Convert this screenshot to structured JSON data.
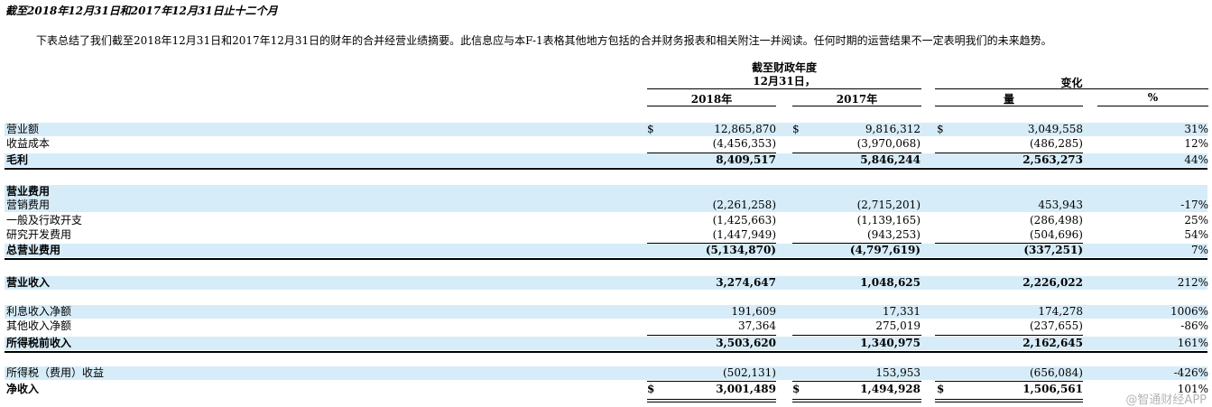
{
  "title": "截至2018年12月31日和2017年12月31日止十二个月",
  "intro": "下表总结了我们截至2018年12月31日和2017年12月31日的财年的合并经营业绩摘要。此信息应与本F-1表格其他地方包括的合并财务报表和相关附注一并阅读。任何时期的运营结果不一定表明我们的未来趋势。",
  "header": {
    "fiscal_line1": "截至财政年度",
    "fiscal_line2": "12月31日，",
    "change": "变化",
    "col_2018": "2018年",
    "col_2017": "2017年",
    "col_amount": "量",
    "col_pct": "%"
  },
  "currency": "$",
  "rows": {
    "revenue": {
      "label": "营业额",
      "v2018": "12,865,870",
      "v2017": "9,816,312",
      "chg": "3,049,558",
      "pct": "31%"
    },
    "cost": {
      "label": "收益成本",
      "v2018": "(4,456,353)",
      "v2017": "(3,970,068)",
      "chg": "(486,285)",
      "pct": "12%"
    },
    "gross": {
      "label": "毛利",
      "v2018": "8,409,517",
      "v2017": "5,846,244",
      "chg": "2,563,273",
      "pct": "44%"
    },
    "opex_header": {
      "label": "营业费用"
    },
    "selling": {
      "label": "营销费用",
      "v2018": "(2,261,258)",
      "v2017": "(2,715,201)",
      "chg": "453,943",
      "pct": "-17%"
    },
    "admin": {
      "label": "一般及行政开支",
      "v2018": "(1,425,663)",
      "v2017": "(1,139,165)",
      "chg": "(286,498)",
      "pct": "25%"
    },
    "rnd": {
      "label": "研究开发费用",
      "v2018": "(1,447,949)",
      "v2017": "(943,253)",
      "chg": "(504,696)",
      "pct": "54%"
    },
    "total_opex": {
      "label": "总营业费用",
      "v2018": "(5,134,870)",
      "v2017": "(4,797,619)",
      "chg": "(337,251)",
      "pct": "7%"
    },
    "op_income": {
      "label": "营业收入",
      "v2018": "3,274,647",
      "v2017": "1,048,625",
      "chg": "2,226,022",
      "pct": "212%"
    },
    "interest": {
      "label": "利息收入净额",
      "v2018": "191,609",
      "v2017": "17,331",
      "chg": "174,278",
      "pct": "1006%"
    },
    "other": {
      "label": "其他收入净额",
      "v2018": "37,364",
      "v2017": "275,019",
      "chg": "(237,655)",
      "pct": "-86%"
    },
    "pretax": {
      "label": "所得税前收入",
      "v2018": "3,503,620",
      "v2017": "1,340,975",
      "chg": "2,162,645",
      "pct": "161%"
    },
    "tax": {
      "label": "所得税（费用）收益",
      "v2018": "(502,131)",
      "v2017": "153,953",
      "chg": "(656,084)",
      "pct": "-426%"
    },
    "net": {
      "label": "净收入",
      "v2018": "3,001,489",
      "v2017": "1,494,928",
      "chg": "1,506,561",
      "pct": "101%"
    }
  },
  "watermark": "@智通财经APP"
}
